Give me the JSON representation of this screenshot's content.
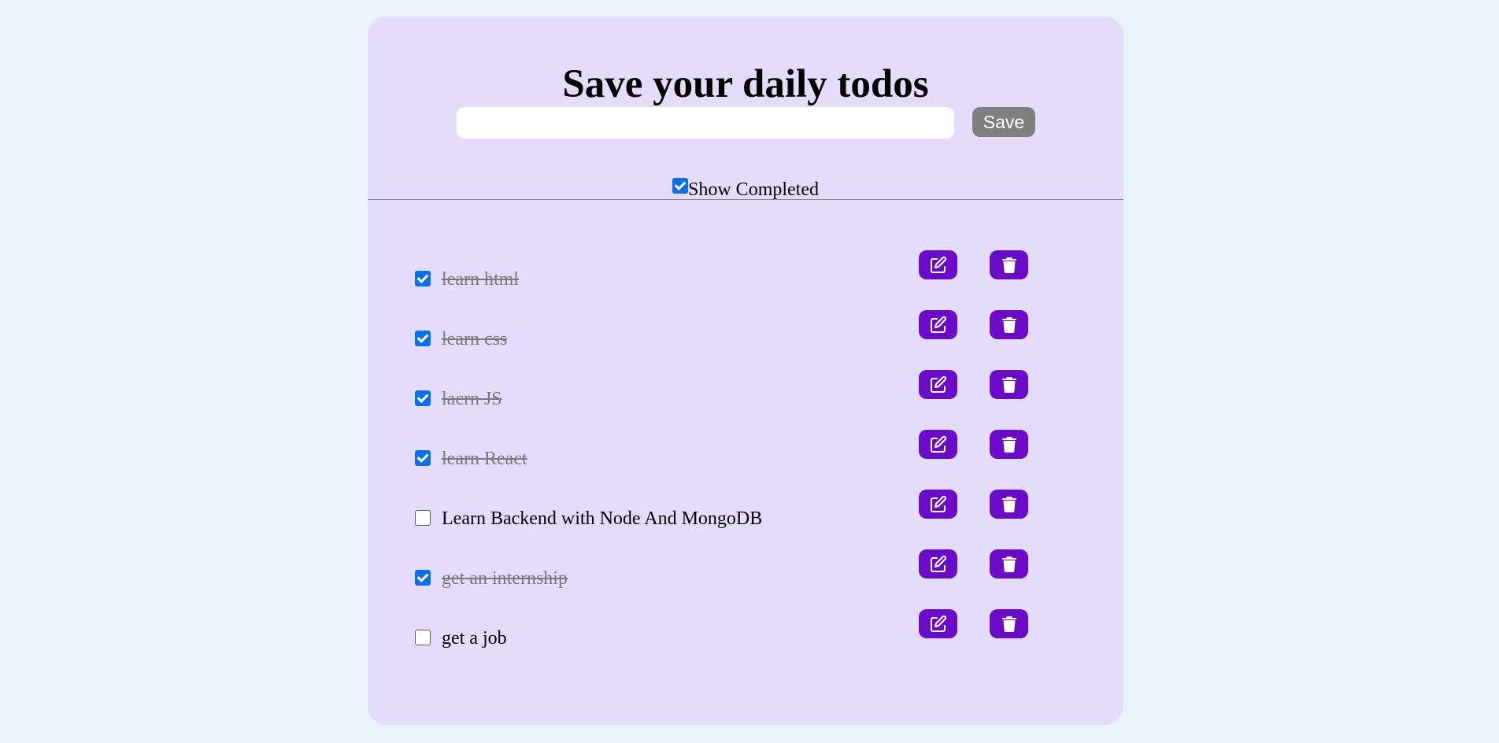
{
  "header": {
    "title": "Save your daily todos"
  },
  "form": {
    "input_value": "",
    "input_placeholder": "",
    "save_label": "Save"
  },
  "filter": {
    "show_completed_label": "Show Completed",
    "show_completed_checked": true
  },
  "todos": [
    {
      "text": "learn html",
      "completed": true
    },
    {
      "text": "learn css",
      "completed": true
    },
    {
      "text": "lacrn JS",
      "completed": true
    },
    {
      "text": "learn React",
      "completed": true
    },
    {
      "text": "Learn Backend with Node And MongoDB",
      "completed": false
    },
    {
      "text": "get an internship",
      "completed": true
    },
    {
      "text": "get a job",
      "completed": false
    }
  ],
  "icons": {
    "edit": "edit-icon",
    "delete": "trash-icon"
  },
  "colors": {
    "page_background": "#e8f3fb",
    "card_background": "#e3dcfa",
    "action_button": "#6a0bc8",
    "save_button": "#7f7f7f",
    "checkbox_checked": "#0b6fe8",
    "completed_text": "#7a7a7a"
  }
}
